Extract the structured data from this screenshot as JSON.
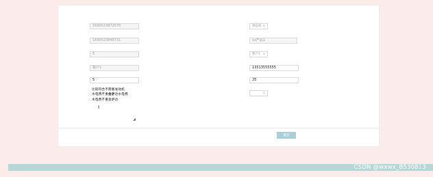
{
  "form": {
    "order_no": {
      "label": "订单号",
      "value": "1690523872570"
    },
    "product_no": {
      "label": "产品编号",
      "value": "1690523848731"
    },
    "price": {
      "label": "价格",
      "value": "5"
    },
    "customer_name": {
      "label": "客户姓名",
      "value": "客户1"
    },
    "order_qty": {
      "label": "下单数量",
      "value": "5"
    },
    "remark": {
      "label": "备注",
      "lines": [
        "比较符合不需看发动机",
        "水电费不重金萨达水电费",
        "水电费不重金萨达"
      ]
    },
    "supplier": {
      "label": "供应商",
      "value": "供应商"
    },
    "product_name": {
      "label": "产品名称",
      "value": "xx产品1"
    },
    "customer": {
      "label": "客户",
      "value": "客户1"
    },
    "phone": {
      "label": "联系电话",
      "value": "13513555555"
    },
    "total_price": {
      "label": "总价格",
      "value": "25"
    },
    "order_status": {
      "label": "订单处理",
      "value": ""
    }
  },
  "actions": {
    "submit_label": "提交"
  },
  "watermark": "CSDN @wxwx_B530813"
}
